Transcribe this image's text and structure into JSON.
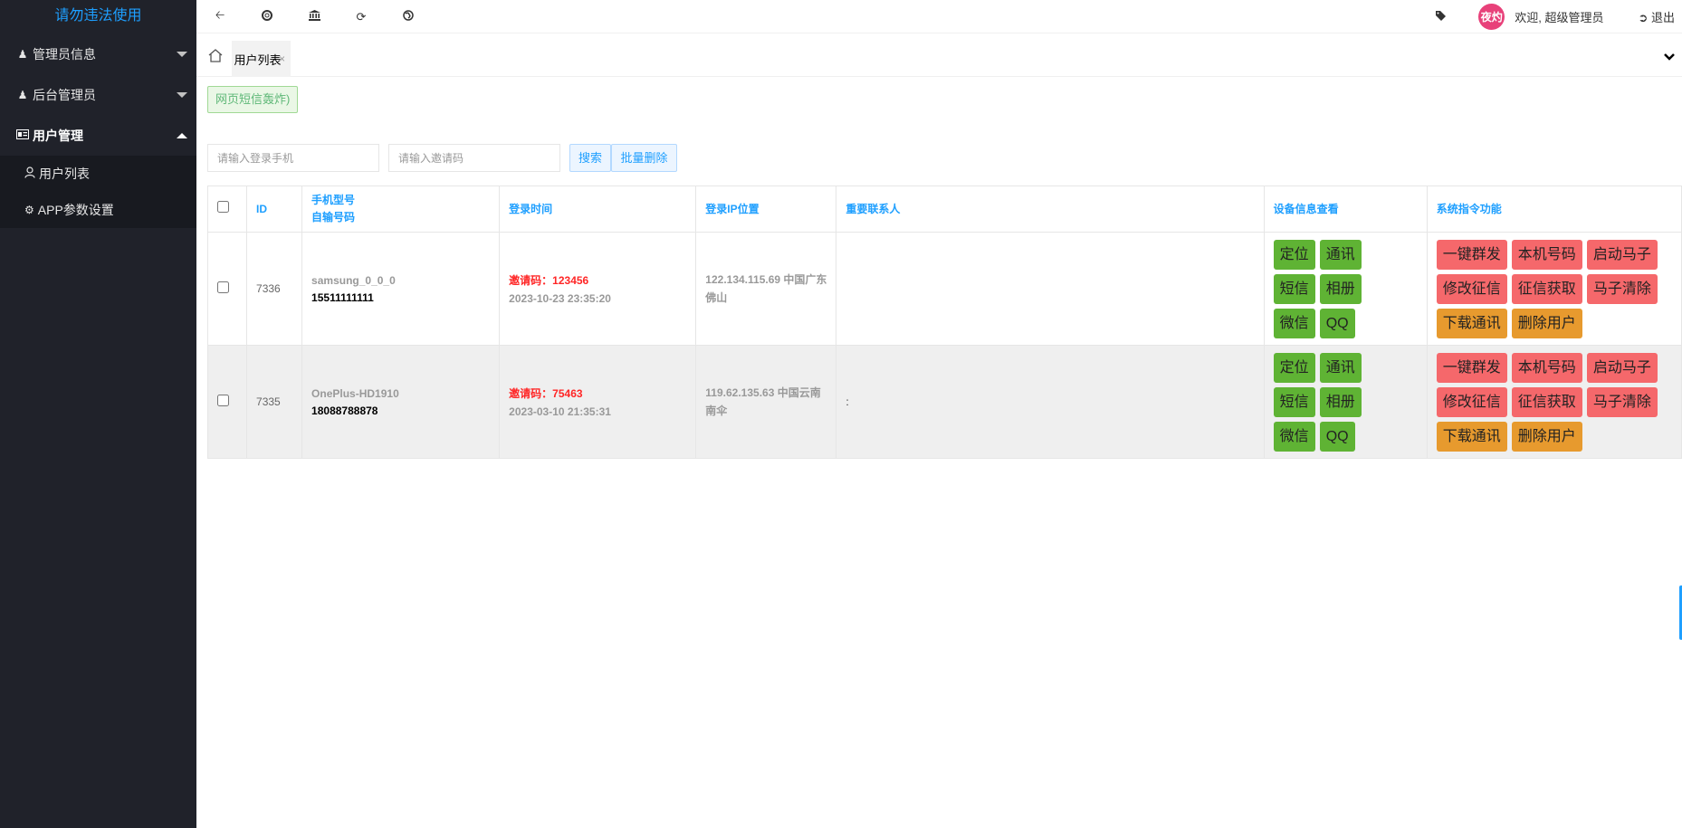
{
  "app": {
    "brand": "请勿违法使用"
  },
  "sidebar": {
    "items": [
      {
        "label": "管理员信息",
        "icon": "user-icon"
      },
      {
        "label": "后台管理员",
        "icon": "user-icon"
      },
      {
        "label": "用户管理",
        "icon": "id-card-icon"
      }
    ],
    "subitems": [
      {
        "label": "用户列表",
        "icon": "user-outline-icon"
      },
      {
        "label": "APP参数设置",
        "icon": "gear-icon"
      }
    ]
  },
  "header": {
    "icons": [
      "back-arrow-icon",
      "lifebuoy-icon",
      "bank-icon",
      "refresh-icon",
      "globe-icon"
    ],
    "avatar_text": "夜灼",
    "welcome": "欢迎, 超级管理员",
    "logout": "退出"
  },
  "tabs": {
    "current": "用户列表",
    "close": "×"
  },
  "toolbar": {
    "sms_button": "网页短信轰炸)",
    "phone_placeholder": "请输入登录手机",
    "invite_placeholder": "请输入邀请码",
    "search": "搜索",
    "batch_delete": "批量删除"
  },
  "table": {
    "headers": {
      "id": "ID",
      "model_line1": "手机型号",
      "model_line2": "自输号码",
      "login_time": "登录时间",
      "ip": "登录IP位置",
      "contacts": "重要联系人",
      "device": "设备信息查看",
      "system": "系统指令功能"
    },
    "device_buttons": [
      "定位",
      "通讯",
      "短信",
      "相册",
      "微信",
      "QQ"
    ],
    "system_buttons": [
      "一键群发",
      "本机号码",
      "启动马子",
      "修改征信",
      "征信获取",
      "马子清除",
      "下载通讯",
      "删除用户"
    ],
    "rows": [
      {
        "id": "7336",
        "model": "samsung_0_0_0",
        "phone": "15511111111",
        "invite": "邀请码：123456",
        "time": "2023-10-23 23:35:20",
        "ip": "122.134.115.69 中国广东佛山",
        "contact": ""
      },
      {
        "id": "7335",
        "model": "OnePlus-HD1910",
        "phone": "18088788878",
        "invite": "邀请码：75463",
        "time": "2023-03-10 21:35:31",
        "ip": "119.62.135.63 中国云南南伞",
        "contact": ":"
      }
    ]
  }
}
